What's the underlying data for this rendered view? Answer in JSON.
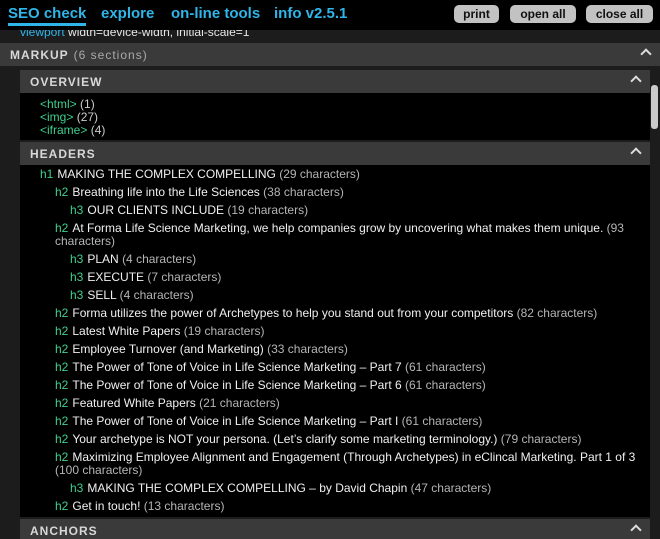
{
  "nav": {
    "tabs": [
      "SEO check",
      "explore",
      "on-line tools",
      "info v2.5.1"
    ],
    "buttons": [
      "print",
      "open all",
      "close all"
    ]
  },
  "peek": {
    "key": "viewport",
    "value": "width=device-width, initial-scale=1"
  },
  "markup": {
    "title": "MARKUP",
    "count": "(6 sections)"
  },
  "overview": {
    "title": "OVERVIEW",
    "items": [
      {
        "tag": "<html>",
        "count": "(1)"
      },
      {
        "tag": "<img>",
        "count": "(27)"
      },
      {
        "tag": "<iframe>",
        "count": "(4)"
      }
    ]
  },
  "headers": {
    "title": "HEADERS",
    "items": [
      {
        "level": "h1",
        "text": "MAKING THE COMPLEX COMPELLING",
        "chars": "(29 characters)"
      },
      {
        "level": "h2",
        "text": "Breathing life into the Life Sciences",
        "chars": "(38 characters)"
      },
      {
        "level": "h3",
        "text": "OUR CLIENTS INCLUDE",
        "chars": "(19 characters)"
      },
      {
        "level": "h2",
        "text": "At Forma Life Science Marketing, we help companies grow by uncovering what makes them unique.",
        "chars": "(93 characters)"
      },
      {
        "level": "h3",
        "text": "PLAN",
        "chars": "(4 characters)"
      },
      {
        "level": "h3",
        "text": "EXECUTE",
        "chars": "(7 characters)"
      },
      {
        "level": "h3",
        "text": "SELL",
        "chars": "(4 characters)"
      },
      {
        "level": "h2",
        "text": "Forma utilizes the power of Archetypes to help you stand out from your competitors",
        "chars": "(82 characters)"
      },
      {
        "level": "h2",
        "text": "Latest White Papers",
        "chars": "(19 characters)"
      },
      {
        "level": "h2",
        "text": "Employee Turnover (and Marketing)",
        "chars": "(33 characters)"
      },
      {
        "level": "h2",
        "text": "The Power of Tone of Voice in Life Science Marketing – Part 7",
        "chars": "(61 characters)"
      },
      {
        "level": "h2",
        "text": "The Power of Tone of Voice in Life Science Marketing – Part 6",
        "chars": "(61 characters)"
      },
      {
        "level": "h2",
        "text": "Featured White Papers",
        "chars": "(21 characters)"
      },
      {
        "level": "h2",
        "text": "The Power of Tone of Voice in Life Science Marketing – Part I",
        "chars": "(61 characters)"
      },
      {
        "level": "h2",
        "text": "Your archetype is NOT your persona. (Let’s clarify some marketing terminology.)",
        "chars": "(79 characters)"
      },
      {
        "level": "h2",
        "text": "Maximizing Employee Alignment and Engagement (Through Archetypes) in eClincal Marketing. Part 1 of 3",
        "chars": "(100 characters)"
      },
      {
        "level": "h3",
        "text": "MAKING THE COMPLEX COMPELLING – by David Chapin",
        "chars": "(47 characters)"
      },
      {
        "level": "h2",
        "text": "Get in touch!",
        "chars": "(13 characters)"
      }
    ]
  },
  "anchors": {
    "title": "ANCHORS"
  }
}
